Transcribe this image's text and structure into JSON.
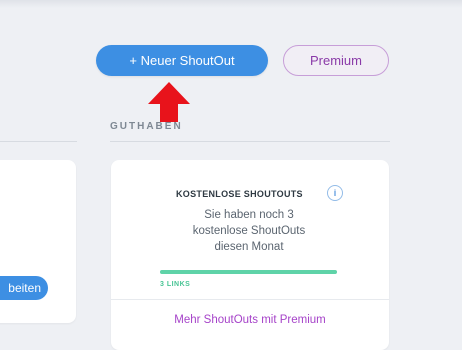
{
  "toolbar": {
    "new_shoutout_label": "+ Neuer ShoutOut",
    "premium_label": "Premium"
  },
  "guthaben": {
    "section_title": "GUTHABEN"
  },
  "left_card": {
    "button_label": "beiten"
  },
  "credit_card": {
    "heading": "KOSTENLOSE SHOUTOUTS",
    "info_glyph": "i",
    "description_line1": "Sie haben noch 3",
    "description_line2": "kostenlose ShoutOuts",
    "description_line3": "diesen Monat",
    "progress_fraction": 1.0,
    "progress_label": "3 LINKS",
    "premium_link": "Mehr ShoutOuts mit Premium"
  },
  "colors": {
    "primary_button": "#3d8fe3",
    "premium_accent": "#8a3aa8",
    "progress": "#5fd3a8",
    "arrow": "#e8131b"
  },
  "icons": {
    "annotation": "red-up-arrow-icon",
    "info": "info-icon"
  }
}
